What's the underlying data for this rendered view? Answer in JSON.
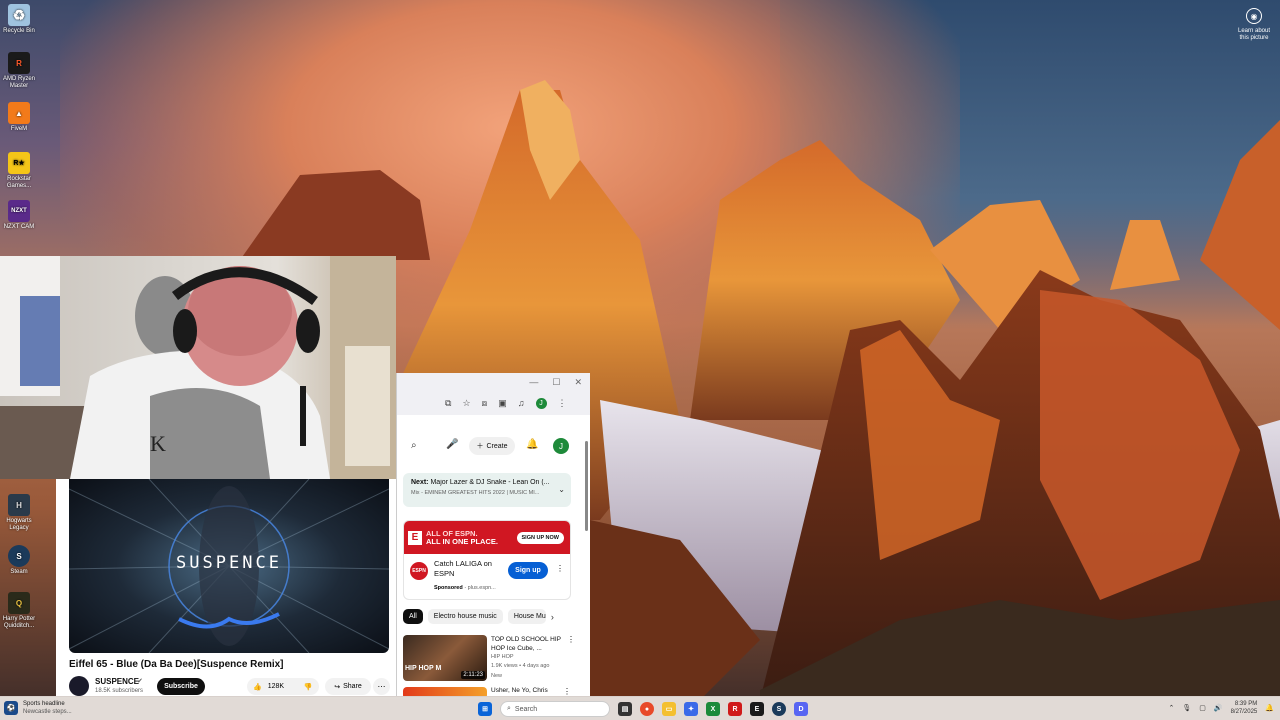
{
  "desktop": {
    "icons": [
      {
        "label": "Recycle Bin",
        "glyph": "♻",
        "color": "#9fc3df"
      },
      {
        "label": "AMD Ryzen Master",
        "glyph": "R",
        "color": "#1a1a1a"
      },
      {
        "label": "FiveM",
        "glyph": "▲",
        "color": "#f27a1a"
      },
      {
        "label": "Rockstar Games...",
        "glyph": "R★",
        "color": "#f4c518"
      },
      {
        "label": "NZXT CAM",
        "glyph": "NZXT",
        "color": "#5a2a8a"
      },
      {
        "label": "Hogwarts Legacy",
        "glyph": "H",
        "color": "#2a3a4a"
      },
      {
        "label": "Steam",
        "glyph": "S",
        "color": "#1b3a5a"
      },
      {
        "label": "Harry Potter Quidditch...",
        "glyph": "Q",
        "color": "#2a2a1a"
      }
    ],
    "learn_label": "Learn about this picture"
  },
  "youtube_main": {
    "overlay_text": "SUSPENCE",
    "video_title": "Eiffel 65 - Blue (Da Ba Dee)[Suspence Remix]",
    "channel_name": "SUSPENCE",
    "subscribers": "18.5K subscribers",
    "subscribe_label": "Subscribe",
    "like_count": "128K",
    "share_label": "Share"
  },
  "browser": {
    "create_label": "Create",
    "avatar_letter": "J",
    "next_label": "Next:",
    "next_title": "Major Lazer & DJ Snake - Lean On (...",
    "next_sub": "Mix - EMINEM GREATEST HITS 2022 | MUSIC MI...",
    "ad_headline_1": "ALL OF ESPN.",
    "ad_headline_2": "ALL IN ONE PLACE.",
    "ad_banner_button": "SIGN UP NOW",
    "ad_title": "Catch LALIGA on ESPN",
    "ad_sponsored": "Sponsored",
    "ad_domain": "plus.espn...",
    "ad_signup": "Sign up",
    "chips": [
      "All",
      "Electro house music",
      "House Mu..."
    ],
    "rec_title": "TOP OLD SCHOOL HIP HOP Ice Cube, ...",
    "rec_channel": "HIP HOP",
    "rec_meta": "1.9K views • 4 days ago",
    "rec_badge": "New",
    "rec_duration": "2:11:23",
    "rec2_title": "Usher, Ne Yo, Chris",
    "thumb_text": "HIP HOP M"
  },
  "taskbar": {
    "news_title": "Sports headline",
    "news_sub": "Newcastle steps...",
    "search_placeholder": "Search",
    "time": "8:39 PM",
    "date": "8/27/2025"
  }
}
